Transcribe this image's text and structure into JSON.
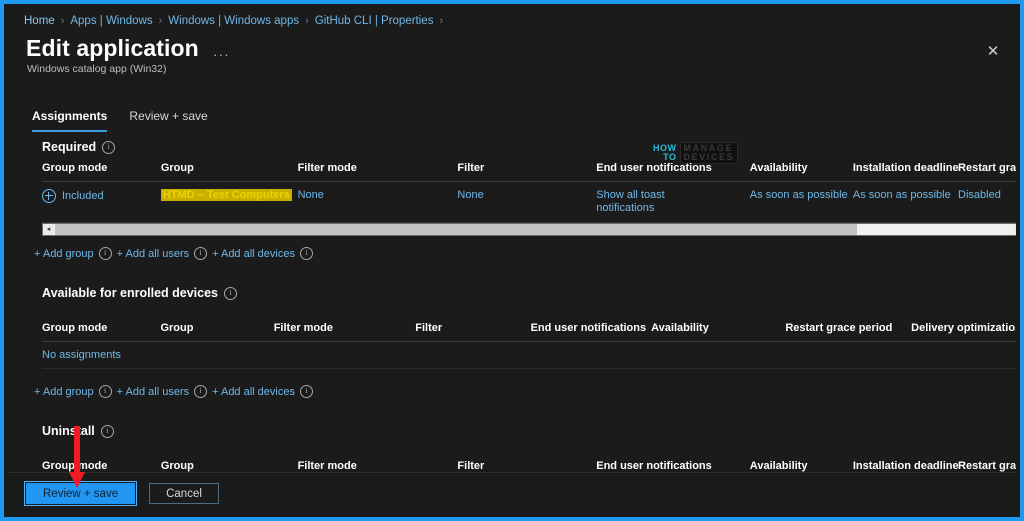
{
  "window": {
    "border_color": "#1e9bf0",
    "background": "#1b1b1b"
  },
  "breadcrumb": {
    "separator": "›",
    "items": [
      "Home",
      "Apps | Windows",
      "Windows | Windows apps",
      "GitHub CLI | Properties"
    ]
  },
  "header": {
    "title": "Edit application",
    "ellipsis": "···",
    "subtitle": "Windows catalog app (Win32)",
    "close_icon": "✕"
  },
  "tabs": [
    {
      "label": "Assignments",
      "active": true
    },
    {
      "label": "Review + save",
      "active": false
    }
  ],
  "info_glyph": "i",
  "sections": {
    "required": {
      "heading": "Required",
      "columns": [
        "Group mode",
        "Group",
        "Filter mode",
        "Filter",
        "End user notifications",
        "Availability",
        "Installation deadline",
        "Restart grace pe"
      ],
      "rows": [
        {
          "group_mode": "Included",
          "group": "HTMD – Test Computers",
          "filter_mode": "None",
          "filter": "None",
          "end_user_notifications": "Show all toast notifications",
          "availability": "As soon as possible",
          "installation_deadline": "As soon as possible",
          "restart_grace_period": "Disabled"
        }
      ],
      "scrollbar": {
        "left_arrow": "◂",
        "right_arrow": "▸"
      }
    },
    "available": {
      "heading": "Available for enrolled devices",
      "columns": [
        "Group mode",
        "Group",
        "Filter mode",
        "Filter",
        "End user notifications",
        "Availability",
        "Restart grace period",
        "Delivery optimizatio..."
      ],
      "empty_text": "No assignments"
    },
    "uninstall": {
      "heading": "Uninstall",
      "columns": [
        "Group mode",
        "Group",
        "Filter mode",
        "Filter",
        "End user notifications",
        "Availability",
        "Installation deadline",
        "Restart grace pe"
      ]
    }
  },
  "add_links": {
    "add_group": "+ Add group",
    "add_all_users": "+ Add all users",
    "add_all_devices": "+ Add all devices"
  },
  "footer": {
    "primary": "Review + save",
    "secondary": "Cancel"
  },
  "watermark": {
    "line1": "HOW",
    "line2": "TO",
    "line3": "MANAGE",
    "line4": "DEVICES",
    "accent": "#2ec7e6"
  },
  "annotation": {
    "arrow_color": "#ee1c25",
    "points_to": "Review + save"
  }
}
